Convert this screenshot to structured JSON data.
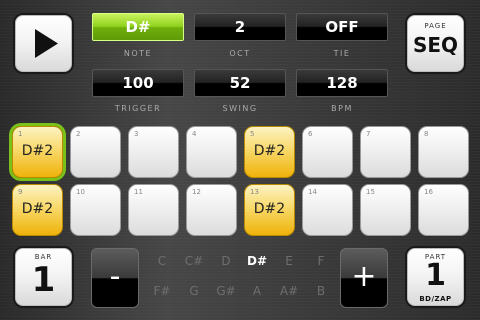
{
  "params": [
    {
      "id": "note",
      "value": "D#",
      "label": "NOTE",
      "active": true
    },
    {
      "id": "oct",
      "value": "2",
      "label": "OCT"
    },
    {
      "id": "tie",
      "value": "OFF",
      "label": "TIE"
    },
    {
      "id": "trigger",
      "value": "100",
      "label": "TRIGGER"
    },
    {
      "id": "swing",
      "value": "52",
      "label": "SWING"
    },
    {
      "id": "bpm",
      "value": "128",
      "label": "BPM"
    }
  ],
  "page": {
    "caption": "PAGE",
    "value": "SEQ"
  },
  "steps": [
    {
      "num": "1",
      "note": "D#2",
      "on": true,
      "current": true
    },
    {
      "num": "2",
      "note": "",
      "on": false
    },
    {
      "num": "3",
      "note": "",
      "on": false
    },
    {
      "num": "4",
      "note": "",
      "on": false
    },
    {
      "num": "5",
      "note": "D#2",
      "on": true
    },
    {
      "num": "6",
      "note": "",
      "on": false
    },
    {
      "num": "7",
      "note": "",
      "on": false
    },
    {
      "num": "8",
      "note": "",
      "on": false
    },
    {
      "num": "9",
      "note": "D#2",
      "on": true
    },
    {
      "num": "10",
      "note": "",
      "on": false
    },
    {
      "num": "11",
      "note": "",
      "on": false
    },
    {
      "num": "12",
      "note": "",
      "on": false
    },
    {
      "num": "13",
      "note": "D#2",
      "on": true
    },
    {
      "num": "14",
      "note": "",
      "on": false
    },
    {
      "num": "15",
      "note": "",
      "on": false
    },
    {
      "num": "16",
      "note": "",
      "on": false
    }
  ],
  "bar": {
    "caption": "BAR",
    "value": "1"
  },
  "part": {
    "caption": "PART",
    "value": "1",
    "sub": "BD/ZAP"
  },
  "minus_label": "-",
  "plus_label": "+",
  "notes": {
    "row1": [
      "C",
      "C#",
      "D",
      "D#",
      "E",
      "F"
    ],
    "row2": [
      "F#",
      "G",
      "G#",
      "A",
      "A#",
      "B"
    ],
    "selected": "D#"
  },
  "icons": {
    "play": "play-icon"
  }
}
